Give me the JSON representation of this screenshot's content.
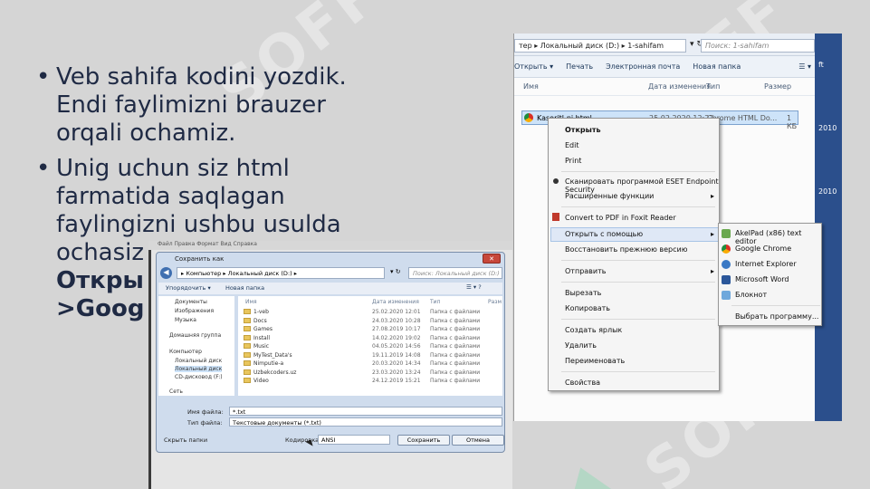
{
  "bullets": [
    {
      "text": "Veb sahifa kodini yozdik. Endi faylimizni brauzer orqali ochamiz."
    },
    {
      "text_plain": "Unig uchun siz html farmatida saqlagan faylingizni ushbu usulda ochasiz",
      "text_bold_1": "Откры",
      "text_bold_2": ">Goog",
      "tail": "/"
    }
  ],
  "explorer": {
    "path": "тер ▸ Локальный диск (D:) ▸ 1-sahifam",
    "search_placeholder": "Поиск: 1-sahifam",
    "toolbar": [
      "Открыть ▾",
      "Печать",
      "Электронная почта",
      "Новая папка"
    ],
    "columns": [
      "Имя",
      "Дата изменения",
      "Тип",
      "Размер"
    ],
    "file": {
      "name": "Kasoritl-ni.html",
      "date": "25.02.2020 12:21",
      "type": "Chrome HTML Do...",
      "size": "1 КБ"
    },
    "side_labels": [
      "ft",
      "2010",
      "2010"
    ]
  },
  "context_menu": {
    "items": [
      "Открыть",
      "Edit",
      "Print",
      "Сканировать программой ESET Endpoint Security",
      "Расширенные функции",
      "Convert to PDF in Foxit Reader",
      "Открыть с помощью",
      "Восстановить прежнюю версию",
      "Отправить",
      "Вырезать",
      "Копировать",
      "Создать ярлык",
      "Удалить",
      "Переименовать",
      "Свойства"
    ]
  },
  "open_with": {
    "items": [
      {
        "label": "AkelPad (x86) text editor",
        "color": "#6aa84f"
      },
      {
        "label": "Google Chrome",
        "color": "#e0a030"
      },
      {
        "label": "Internet Explorer",
        "color": "#3a78c4"
      },
      {
        "label": "Microsoft Word",
        "color": "#2b579a"
      },
      {
        "label": "Блокнот",
        "color": "#6fa8dc"
      }
    ],
    "choose": "Выбрать программу..."
  },
  "save_dialog": {
    "menubar": "Файл   Правка   Формат   Вид   Справка",
    "title": "Сохранить как",
    "close": "✕",
    "path": "▸ Компьютер ▸ Локальный диск (D:) ▸",
    "search_placeholder": "Поиск: Локальный диск (D:)",
    "toolbar": [
      "Упорядочить ▾",
      "Новая папка"
    ],
    "tree": [
      "Документы",
      "Изображения",
      "Музыка",
      "Домашняя группа",
      "Компьютер",
      "Локальный диск",
      "Локальный диск",
      "CD-дисковод (F:)",
      "Сеть"
    ],
    "columns": [
      "Имя",
      "Дата изменения",
      "Тип",
      "Разм"
    ],
    "folders": [
      {
        "name": "1-veb",
        "date": "25.02.2020 12:01",
        "type": "Папка с файлами"
      },
      {
        "name": "Docs",
        "date": "24.03.2020 10:28",
        "type": "Папка с файлами"
      },
      {
        "name": "Games",
        "date": "27.08.2019 10:17",
        "type": "Папка с файлами"
      },
      {
        "name": "Install",
        "date": "14.02.2020 19:02",
        "type": "Папка с файлами"
      },
      {
        "name": "Music",
        "date": "04.05.2020 14:56",
        "type": "Папка с файлами"
      },
      {
        "name": "MyTest_Data's",
        "date": "19.11.2019 14:08",
        "type": "Папка с файлами"
      },
      {
        "name": "Nimputie-a",
        "date": "20.03.2020 14:34",
        "type": "Папка с файлами"
      },
      {
        "name": "Uzbekcoders.uz",
        "date": "23.03.2020 13:24",
        "type": "Папка с файлами"
      },
      {
        "name": "Video",
        "date": "24.12.2019 15:21",
        "type": "Папка с файлами"
      }
    ],
    "filename_label": "Имя файла:",
    "filename_value": "*.txt",
    "filetype_label": "Тип файла:",
    "filetype_value": "Текстовые документы (*.txt)",
    "hide_folders": "Скрыть папки",
    "encoding_label": "Кодировка:",
    "encoding_value": "ANSI",
    "save_button": "Сохранить",
    "cancel_button": "Отмена"
  },
  "watermark": "SOFF"
}
